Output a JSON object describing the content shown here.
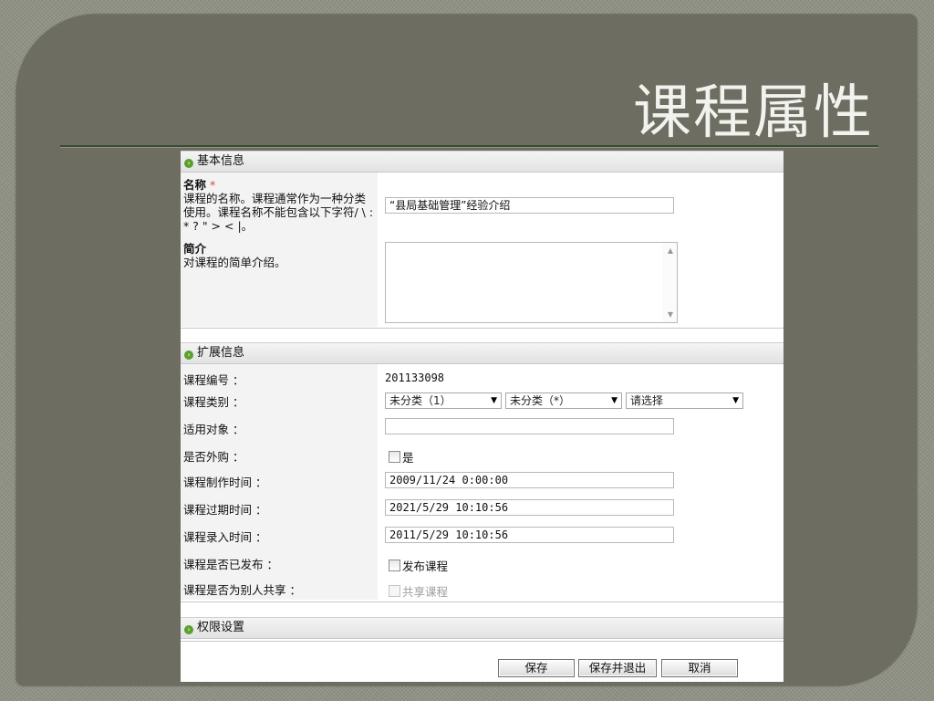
{
  "slide": {
    "title": "课程属性"
  },
  "basic_section": {
    "header": "基本信息",
    "name_label": "名称",
    "required_mark": "*",
    "name_desc": "课程的名称。课程通常作为一种分类使用。课程名称不能包含以下字符/ \\ : * ? \" > < |。",
    "name_value": "“县局基础管理”经验介绍",
    "intro_label": "简介",
    "intro_desc": "对课程的简单介绍。",
    "intro_value": ""
  },
  "ext_section": {
    "header": "扩展信息",
    "course_no_label": "课程编号 ：",
    "course_no_value": "201133098",
    "category_label": "课程类别 ：",
    "category_select_1": "未分类（1）",
    "category_select_2": "未分类（*）",
    "category_select_3": "请选择",
    "audience_label": "适用对象 ：",
    "audience_value": "",
    "purchased_label": "是否外购 ：",
    "purchased_check": "是",
    "made_time_label": "课程制作时间 ：",
    "made_time_value": "2009/11/24 0:00:00",
    "expire_time_label": "课程过期时间 ：",
    "expire_time_value": "2021/5/29 10:10:56",
    "entry_time_label": "课程录入时间 ：",
    "entry_time_value": "2011/5/29 10:10:56",
    "published_label": "课程是否已发布 ：",
    "published_check": "发布课程",
    "shared_label": "课程是否为别人共享 ：",
    "shared_check": "共享课程"
  },
  "perm_section": {
    "header": "权限设置"
  },
  "buttons": {
    "save": "保存",
    "save_exit": "保存并退出",
    "cancel": "取消"
  },
  "colors": {
    "slide_bg": "#6d6e61",
    "accent_green": "#5aa02c",
    "title_text": "#f2f2ee"
  }
}
